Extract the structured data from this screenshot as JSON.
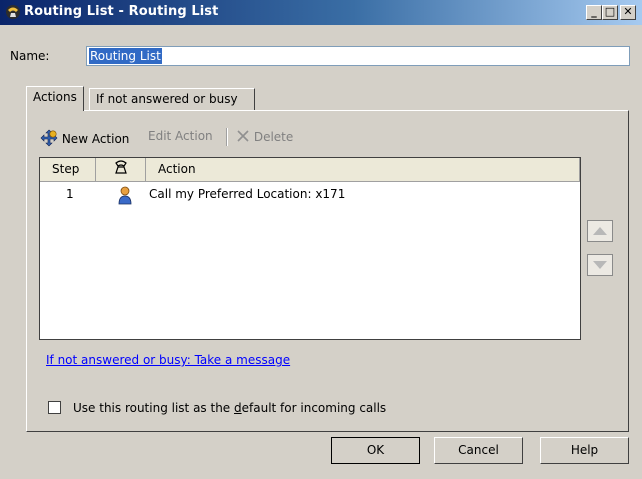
{
  "window": {
    "title": "Routing List - Routing List"
  },
  "name": {
    "label": "Name:",
    "value": "Routing List"
  },
  "tabs": [
    {
      "label": "Actions",
      "active": true
    },
    {
      "label": "If not answered or busy",
      "active": false
    }
  ],
  "toolbar": {
    "new_label": "New Action",
    "edit_label": "Edit Action",
    "delete_label": "Delete",
    "icons": {
      "new": "move-cross-icon",
      "delete": "x-icon"
    }
  },
  "table": {
    "headers": {
      "step": "Step",
      "icon": "phone-handset-icon",
      "action": "Action"
    },
    "rows": [
      {
        "step": "1",
        "icon": "person-icon",
        "action": "Call my Preferred Location: x171"
      }
    ]
  },
  "link": {
    "text": "If not answered or busy: Take a message"
  },
  "checkbox": {
    "label": "Use this routing list as the default for incoming calls",
    "checked": false
  },
  "buttons": {
    "ok": "OK",
    "cancel": "Cancel",
    "help": "Help"
  },
  "colors": {
    "titlebar_start": "#0a246a",
    "titlebar_end": "#a6caf0",
    "dialog_bg": "#d4d0c8",
    "link": "#0000ff",
    "selection": "#316ac5"
  }
}
